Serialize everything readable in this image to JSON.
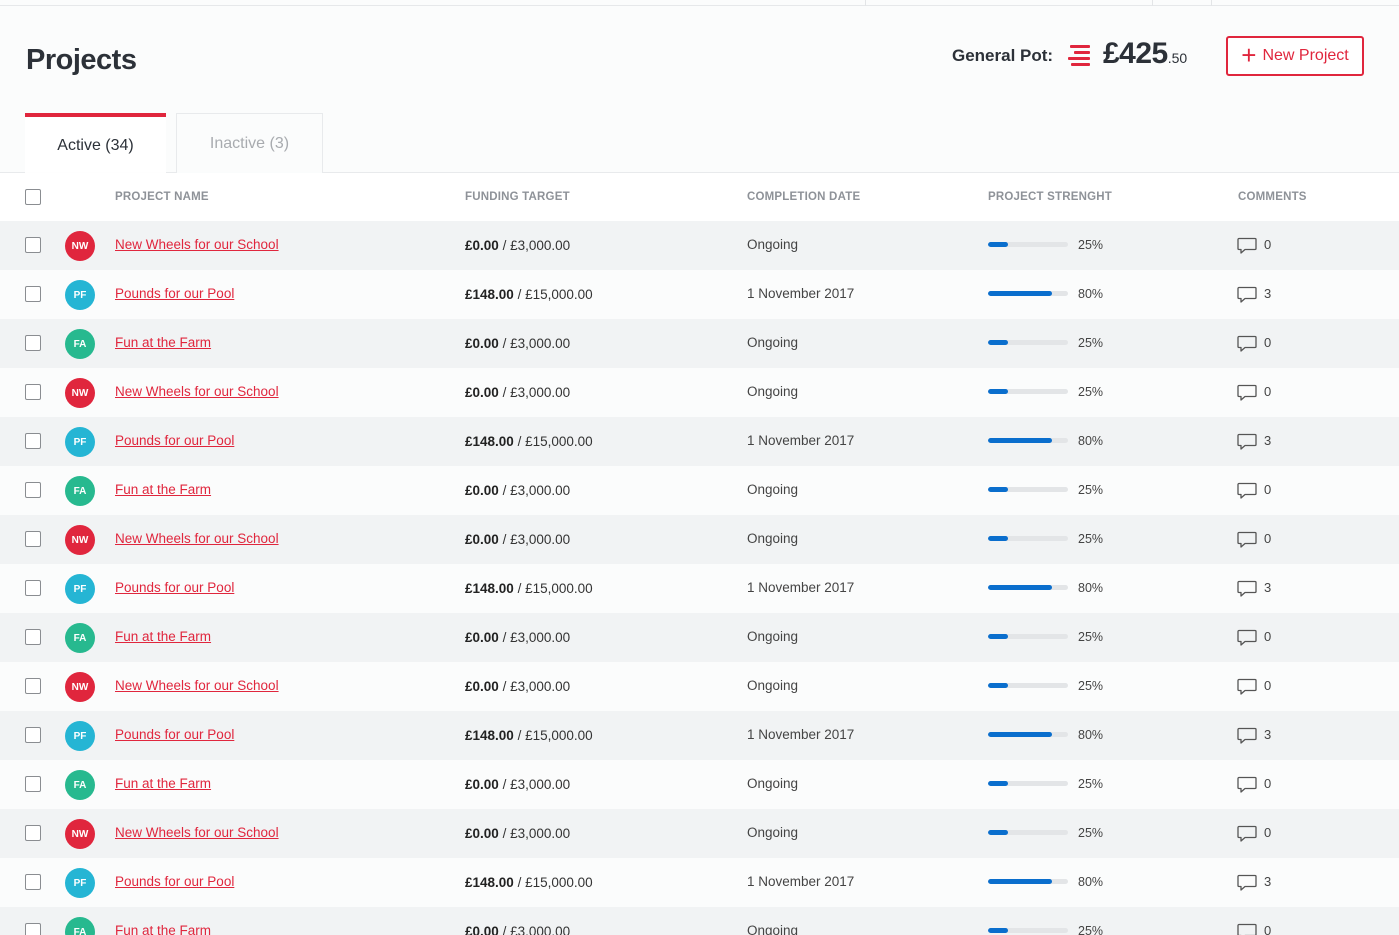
{
  "header": {
    "title": "Projects",
    "pot_label": "General Pot:",
    "pot_amount": "£425",
    "pot_cents": ".50",
    "new_project_label": "New Project"
  },
  "tabs": [
    {
      "label": "Active (34)",
      "active": true
    },
    {
      "label": "Inactive (3)",
      "active": false
    }
  ],
  "columns": {
    "name": "PROJECT NAME",
    "funding": "FUNDING TARGET",
    "date": "COMPLETION DATE",
    "strength": "PROJECT STRENGHT",
    "comments": "COMMENTS"
  },
  "colors": {
    "accent": "#e0263d",
    "NW": "#e0263d",
    "PF": "#25b5d4",
    "FA": "#27b98f",
    "progress": "#0a6ecd"
  },
  "icons": {
    "comment": "comment-bubble-icon",
    "pot": "stacked-coins-icon",
    "plus": "plus-icon"
  },
  "rows": [
    {
      "initials": "NW",
      "name": "New Wheels for our School",
      "raised": "£0.00",
      "target": "/ £3,000.00",
      "date": "Ongoing",
      "strength": 25,
      "strength_label": "25%",
      "comments": "0"
    },
    {
      "initials": "PF",
      "name": "Pounds for our Pool",
      "raised": "£148.00",
      "target": "/ £15,000.00",
      "date": "1 November 2017",
      "strength": 80,
      "strength_label": "80%",
      "comments": "3"
    },
    {
      "initials": "FA",
      "name": "Fun at the Farm",
      "raised": "£0.00",
      "target": "/ £3,000.00",
      "date": "Ongoing",
      "strength": 25,
      "strength_label": "25%",
      "comments": "0"
    },
    {
      "initials": "NW",
      "name": "New Wheels for our School",
      "raised": "£0.00",
      "target": "/ £3,000.00",
      "date": "Ongoing",
      "strength": 25,
      "strength_label": "25%",
      "comments": "0"
    },
    {
      "initials": "PF",
      "name": "Pounds for our Pool",
      "raised": "£148.00",
      "target": "/ £15,000.00",
      "date": "1 November 2017",
      "strength": 80,
      "strength_label": "80%",
      "comments": "3"
    },
    {
      "initials": "FA",
      "name": "Fun at the Farm",
      "raised": "£0.00",
      "target": "/ £3,000.00",
      "date": "Ongoing",
      "strength": 25,
      "strength_label": "25%",
      "comments": "0"
    },
    {
      "initials": "NW",
      "name": "New Wheels for our School",
      "raised": "£0.00",
      "target": "/ £3,000.00",
      "date": "Ongoing",
      "strength": 25,
      "strength_label": "25%",
      "comments": "0"
    },
    {
      "initials": "PF",
      "name": "Pounds for our Pool",
      "raised": "£148.00",
      "target": "/ £15,000.00",
      "date": "1 November 2017",
      "strength": 80,
      "strength_label": "80%",
      "comments": "3"
    },
    {
      "initials": "FA",
      "name": "Fun at the Farm",
      "raised": "£0.00",
      "target": "/ £3,000.00",
      "date": "Ongoing",
      "strength": 25,
      "strength_label": "25%",
      "comments": "0"
    },
    {
      "initials": "NW",
      "name": "New Wheels for our School",
      "raised": "£0.00",
      "target": "/ £3,000.00",
      "date": "Ongoing",
      "strength": 25,
      "strength_label": "25%",
      "comments": "0"
    },
    {
      "initials": "PF",
      "name": "Pounds for our Pool",
      "raised": "£148.00",
      "target": "/ £15,000.00",
      "date": "1 November 2017",
      "strength": 80,
      "strength_label": "80%",
      "comments": "3"
    },
    {
      "initials": "FA",
      "name": "Fun at the Farm",
      "raised": "£0.00",
      "target": "/ £3,000.00",
      "date": "Ongoing",
      "strength": 25,
      "strength_label": "25%",
      "comments": "0"
    },
    {
      "initials": "NW",
      "name": "New Wheels for our School",
      "raised": "£0.00",
      "target": "/ £3,000.00",
      "date": "Ongoing",
      "strength": 25,
      "strength_label": "25%",
      "comments": "0"
    },
    {
      "initials": "PF",
      "name": "Pounds for our Pool",
      "raised": "£148.00",
      "target": "/ £15,000.00",
      "date": "1 November 2017",
      "strength": 80,
      "strength_label": "80%",
      "comments": "3"
    },
    {
      "initials": "FA",
      "name": "Fun at the Farm",
      "raised": "£0.00",
      "target": "/ £3,000.00",
      "date": "Ongoing",
      "strength": 25,
      "strength_label": "25%",
      "comments": "0"
    }
  ]
}
